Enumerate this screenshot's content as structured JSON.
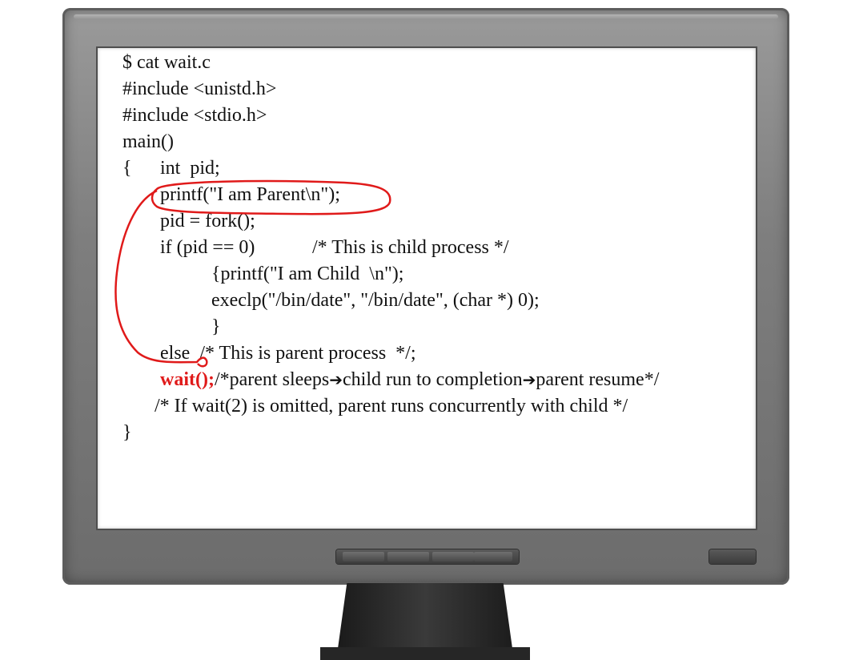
{
  "code": {
    "line1": "$ cat wait.c",
    "line2": "#include <unistd.h>",
    "line3": "#include <stdio.h>",
    "line4": "main()",
    "line5_brace": "{",
    "line5": "int  pid;",
    "line6": "printf(\"I am Parent\\n\");",
    "line7": "pid = fork();",
    "line8_code": "if (pid == 0)",
    "line8_comment": "/* This is child process */",
    "line9": "{printf(\"I am Child  \\n\");",
    "line10": "execlp(\"/bin/date\", \"/bin/date\", (char *) 0);",
    "line11": "}",
    "line12": "else  /* This is parent process  */;",
    "line13_call": "wait();",
    "line13_comment_a": "/*parent sleeps",
    "line13_comment_b": "child run to completion",
    "line13_comment_c": "parent resume*/",
    "arrow_glyph": "➔",
    "line14": "/* If wait(2) is omitted, parent runs concurrently with child */",
    "line15": "}"
  },
  "colors": {
    "annotation": "#e01a1a",
    "text": "#111111"
  }
}
